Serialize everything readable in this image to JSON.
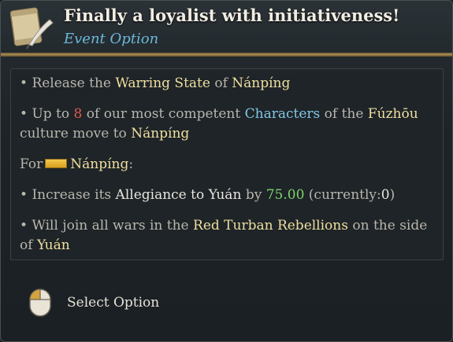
{
  "header": {
    "title": "Finally a loyalist with initiativeness!",
    "subtitle": "Event Option",
    "icon": "scroll-quill-icon"
  },
  "effects": {
    "line1": {
      "bullet": "•",
      "t1": "Release the",
      "h1": "Warring State",
      "t2": "of",
      "h2": "Nánpíng"
    },
    "line2": {
      "bullet": "•",
      "t1": "Up to",
      "n1": "8",
      "t2": "of our most competent",
      "h1": "Characters",
      "t3": "of the",
      "h2": "Fúzhōu"
    },
    "line3": {
      "t1": "culture move to",
      "h1": "Nánpíng"
    },
    "line4": {
      "t1": "For",
      "flag_icon": "nanping-flag-icon",
      "h1": "Nánpíng",
      "t2": ":"
    },
    "line5": {
      "bullet": "•",
      "t1": "Increase its",
      "h1": "Allegiance to Yuán",
      "t2": "by",
      "n1": "75.00",
      "t3": "(currently:",
      "n2": "0",
      "t4": ")"
    },
    "line6": {
      "bullet": "•",
      "t1": "Will join all wars in the",
      "h1": "Red Turban Rebellions",
      "t2": "on the side"
    },
    "line7": {
      "t1": "of",
      "h1": "Yuán"
    }
  },
  "action": {
    "label": "Select Option",
    "icon": "left-mouse-button-icon"
  },
  "colors": {
    "highlight_gold": "#f0dfa0",
    "highlight_blue": "#82c8e6",
    "number_red": "#e05a50",
    "number_green": "#7fd36e",
    "subtitle_blue": "#6ab7d8"
  }
}
